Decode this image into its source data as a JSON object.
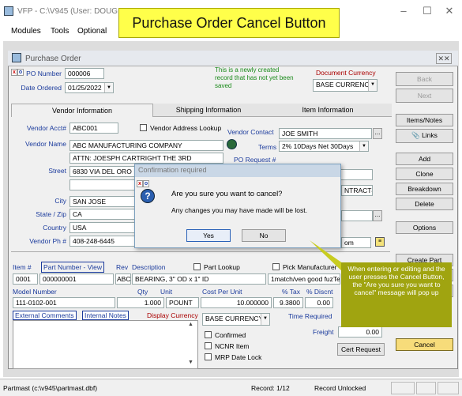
{
  "window": {
    "title": "VFP - C:\\V945 (User: DOUG"
  },
  "menu": [
    "Modules",
    "Tools",
    "Optional"
  ],
  "callout": "Purchase Order Cancel Button",
  "form": {
    "title": "Purchase Order",
    "po_number_label": "PO Number",
    "po_number": "000006",
    "date_label": "Date Ordered",
    "date": "01/25/2022",
    "status_note": "This is a newly created record that has not yet been saved",
    "currency_label": "Document Currency",
    "currency": "BASE CURRENCY",
    "tabs": [
      "Vendor Information",
      "Shipping Information",
      "Item Information"
    ],
    "vendor_acct_label": "Vendor Acct#",
    "vendor_acct": "ABC001",
    "vendor_lookup_label": "Vendor Address Lookup",
    "vendor_contact_label": "Vendor Contact",
    "vendor_contact": "JOE SMITH",
    "vendor_name_label": "Vendor Name",
    "vendor_name": "ABC MANUFACTURING COMPANY",
    "terms_label": "Terms",
    "terms": "2% 10Days Net 30Days",
    "attn": "ATTN: JOESPH CARTRIGHT THE 3RD",
    "po_request_label": "PO Request #",
    "street_label": "Street",
    "street": "6830 VIA DEL ORO",
    "contract_fragment": "NTRACT#",
    "city_label": "City",
    "city": "SAN JOSE",
    "state_label": "State / Zip",
    "state": "CA",
    "country_label": "Country",
    "country": "USA",
    "phone_label": "Vendor Ph #",
    "phone": "408-248-6445",
    "email_fragment": "om",
    "item_header": {
      "item": "Item #",
      "part": "Part Number - View",
      "rev": "Rev",
      "desc": "Description",
      "part_lookup": "Part Lookup",
      "pick_mfr": "Pick Manufacturer"
    },
    "item_row": {
      "item": "0001",
      "part": "000000001",
      "rev": "ABC",
      "desc": "BEARING, 3\" OD x 1\" ID",
      "mfr_note": "1match/ven good fuzTe"
    },
    "model_header": {
      "model": "Model Number",
      "qty": "Qty",
      "unit": "Unit",
      "cost": "Cost Per Unit",
      "tax": "% Tax",
      "disc": "% Discnt"
    },
    "model_row": {
      "model": "111-0102-001",
      "qty": "1.000",
      "unit": "POUNT",
      "cost": "10.000000",
      "tax": "9.3800",
      "disc": "0.00"
    },
    "notes_tabs": [
      "External Comments",
      "Internal Notes"
    ],
    "display_currency_label": "Display Currency",
    "display_currency": "BASE CURRENCY",
    "time_required_label": "Time Required",
    "freight_label": "Freight",
    "freight": "0.00",
    "checks": [
      "Confirmed",
      "NCNR Item",
      "MRP Date Lock"
    ],
    "cert_button": "Cert Request"
  },
  "side_buttons": {
    "back": "Back",
    "next": "Next",
    "items_notes": "Items/Notes",
    "links": "Links",
    "add": "Add",
    "clone": "Clone",
    "breakdown": "Breakdown",
    "delete": "Delete",
    "options": "Options",
    "create_part": "Create Part",
    "ss_fragment": "ss",
    "rt_fragment": "rt",
    "cancel": "Cancel"
  },
  "dialog": {
    "title": "Confirmation required",
    "question": "Are you sure you want to cancel?",
    "message": "Any changes you may have made will be lost.",
    "yes": "Yes",
    "no": "No"
  },
  "tooltip": "When entering or editing and the user presses the Cancel Button, the \"Are you sure you want to cancel\" message will pop up",
  "status": {
    "path": "Partmast (c:\\v945\\partmast.dbf)",
    "record": "Record: 1/12",
    "lock": "Record Unlocked"
  }
}
